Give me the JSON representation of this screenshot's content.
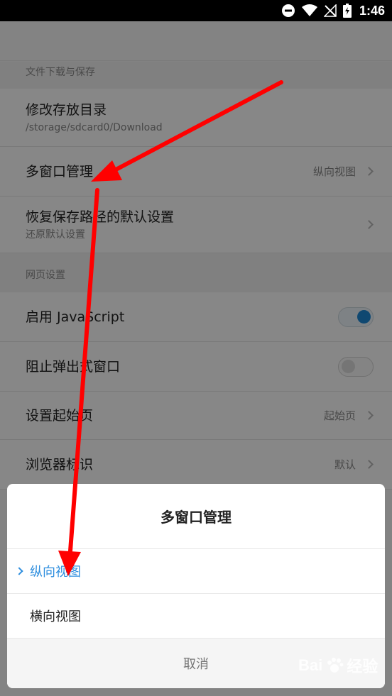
{
  "status_bar": {
    "time": "1:46",
    "icons": [
      "do-not-disturb-icon",
      "wifi-icon",
      "no-signal-icon",
      "battery-charging-icon"
    ]
  },
  "settings": {
    "section_download": "文件下载与保存",
    "change_dir": {
      "title": "修改存放目录",
      "sub": "/storage/sdcard0/Download"
    },
    "multi_window": {
      "title": "多窗口管理",
      "value": "纵向视图"
    },
    "restore_path": {
      "title": "恢复保存路径的默认设置",
      "sub": "还原默认设置"
    },
    "section_web": "网页设置",
    "enable_js": {
      "title": "启用 JavaScript",
      "on": true
    },
    "block_popups": {
      "title": "阻止弹出式窗口",
      "on": false
    },
    "homepage": {
      "title": "设置起始页",
      "value": "起始页"
    },
    "browser_id": {
      "title": "浏览器标识",
      "value": "默认"
    }
  },
  "dialog": {
    "title": "多窗口管理",
    "options": [
      {
        "label": "纵向视图",
        "selected": true
      },
      {
        "label": "横向视图",
        "selected": false
      }
    ],
    "cancel": "取消"
  },
  "annotation": {
    "color": "#ff0000"
  },
  "watermark": {
    "text": "Bai",
    "text2": "经验"
  }
}
